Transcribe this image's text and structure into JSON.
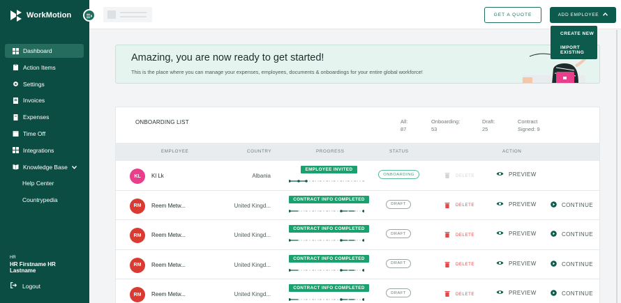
{
  "brand": {
    "name": "WorkMotion",
    "primary": "#0c4d43",
    "accent": "#1aa16e"
  },
  "sidebar": {
    "items": [
      {
        "label": "Dashboard",
        "icon": "dashboard-icon",
        "active": true
      },
      {
        "label": "Action Items",
        "icon": "clipboard-icon"
      },
      {
        "label": "Settings",
        "icon": "gear-icon"
      },
      {
        "label": "Invoices",
        "icon": "invoice-icon"
      },
      {
        "label": "Expenses",
        "icon": "expenses-icon"
      },
      {
        "label": "Time Off",
        "icon": "calendar-icon"
      },
      {
        "label": "Integrations",
        "icon": "grid-icon"
      },
      {
        "label": "Knowledge Base",
        "icon": "book-icon"
      },
      {
        "label": "Help Center"
      },
      {
        "label": "Countrypedia"
      }
    ],
    "user": {
      "role": "HR",
      "name": "HR Firstname HR Lastname"
    },
    "logout": "Logout"
  },
  "topbar": {
    "quote_label": "GET A QUOTE",
    "add_label": "ADD EMPLOYEE",
    "dropdown": [
      "CREATE NEW",
      "IMPORT EXISTING"
    ]
  },
  "banner": {
    "title": "Amazing, you are now ready to get started!",
    "text": "This is the place where you can manage your expenses, employees, documents & onboardings for your entire global workforce!"
  },
  "onboarding": {
    "title": "ONBOARDING LIST",
    "stats": [
      {
        "label": "All:",
        "value": "87"
      },
      {
        "label": "Onboarding:",
        "value": "53"
      },
      {
        "label": "Draft:",
        "value": "25"
      },
      {
        "label": "Contract",
        "label2": "Signed:",
        "value": "9"
      }
    ],
    "columns": [
      "EMPLOYEE",
      "COUNTRY",
      "PROGRESS",
      "STATUS",
      "ACTION"
    ],
    "delete_label": "DELETE",
    "preview_label": "PREVIEW",
    "continue_label": "CONTINUE",
    "rows": [
      {
        "initials": "KL",
        "avatar_color": "#e83e8c",
        "name": "Kl Lk",
        "country": "Albania",
        "progress": "EMPLOYEE INVITED",
        "status": "ONBOARDING",
        "delete_enabled": false,
        "can_continue": false
      },
      {
        "initials": "RM",
        "avatar_color": "#d93a32",
        "name": "Reem Metw...",
        "country": "United Kingd...",
        "progress": "CONTRACT INFO COMPLETED",
        "status": "DRAFT",
        "delete_enabled": true,
        "can_continue": true
      },
      {
        "initials": "RM",
        "avatar_color": "#d93a32",
        "name": "Reem Metw...",
        "country": "United Kingd...",
        "progress": "CONTRACT INFO COMPLETED",
        "status": "DRAFT",
        "delete_enabled": true,
        "can_continue": true
      },
      {
        "initials": "RM",
        "avatar_color": "#d93a32",
        "name": "Reem Metw...",
        "country": "United Kingd...",
        "progress": "CONTRACT INFO COMPLETED",
        "status": "DRAFT",
        "delete_enabled": true,
        "can_continue": true
      },
      {
        "initials": "RM",
        "avatar_color": "#d93a32",
        "name": "Reem Metw...",
        "country": "United Kingd...",
        "progress": "CONTRACT INFO COMPLETED",
        "status": "DRAFT",
        "delete_enabled": true,
        "can_continue": true
      }
    ]
  }
}
